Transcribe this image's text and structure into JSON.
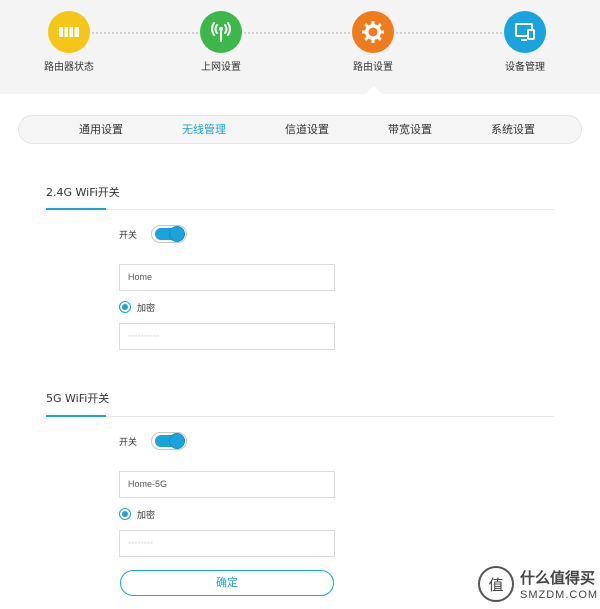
{
  "steps": [
    {
      "label": "路由器状态",
      "color": "#f5c518",
      "icon": "router-status-icon"
    },
    {
      "label": "上网设置",
      "color": "#3cb84a",
      "icon": "signal-tower-icon"
    },
    {
      "label": "路由设置",
      "color": "#f07b1d",
      "icon": "gear-icon",
      "active": true
    },
    {
      "label": "设备管理",
      "color": "#1aa3dc",
      "icon": "device-monitor-icon"
    }
  ],
  "tabs": [
    {
      "label": "通用设置"
    },
    {
      "label": "无线管理",
      "active": true
    },
    {
      "label": "信道设置"
    },
    {
      "label": "带宽设置"
    },
    {
      "label": "系统设置"
    }
  ],
  "wifi24": {
    "title": "2.4G WiFi开关",
    "switch_label": "开关",
    "switch_on": true,
    "ssid_value": "Home",
    "encrypt_label": "加密",
    "password_masked": "••••••••••"
  },
  "wifi5": {
    "title": "5G WiFi开关",
    "switch_label": "开关",
    "switch_on": true,
    "ssid_value": "Home-5G",
    "encrypt_label": "加密",
    "password_masked": "••••••••"
  },
  "confirm_label": "确定",
  "watermark": {
    "logo_glyph": "值",
    "line1": "什么值得买",
    "line2": "SMZDM.COM"
  },
  "colors": {
    "accent": "#1ba4d9",
    "step_yellow": "#f5c518",
    "step_green": "#3cb84a",
    "step_orange": "#f07b1d",
    "step_blue": "#1aa3dc"
  }
}
